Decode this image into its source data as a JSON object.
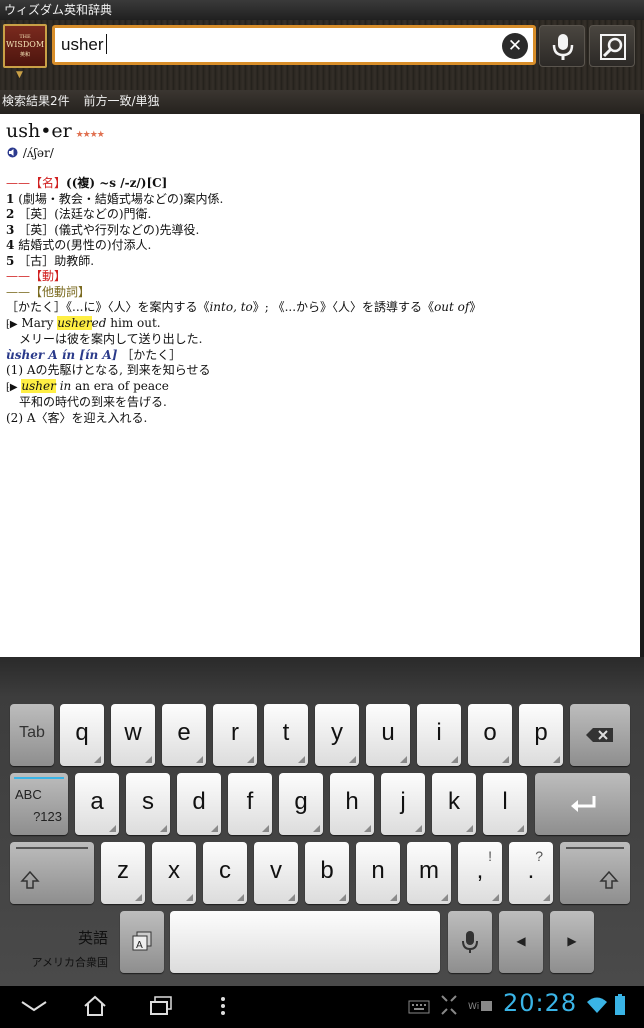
{
  "app": {
    "title": "ウィズダム英和辞典"
  },
  "logo": {
    "line1": "THE",
    "line2": "WISDOM",
    "line3": "英和"
  },
  "search": {
    "value": "usher"
  },
  "results": {
    "count": "検索結果2件",
    "mode": "前方一致/単独"
  },
  "entry": {
    "headword": "ush•er",
    "stars": "★★★★",
    "pron": "/ʌ́ʃər/",
    "pos1": "【名】",
    "plural": "((複) ~s /-z/)[C]",
    "senses": [
      {
        "num": "1",
        "text": "(劇場・教会・結婚式場などの)案内係."
      },
      {
        "num": "2",
        "text": "［英］(法廷などの)門衛."
      },
      {
        "num": "3",
        "text": "［英］(儀式や行列などの)先導役."
      },
      {
        "num": "4",
        "text": "結婚式の(男性の)付添人."
      },
      {
        "num": "5",
        "text": "［古］助教師."
      }
    ],
    "pos2": "【動】",
    "pos3": "【他動詞】",
    "verb_def_a": "［かたく］《...に》〈人〉を案内する《",
    "verb_def_b": "into, to",
    "verb_def_c": "》; 《...から》〈人〉を誘導する《",
    "verb_def_d": "out of",
    "verb_def_e": "》",
    "ex1_pre": "Mary ",
    "ex1_hl": "usher",
    "ex1_post_it": "ed",
    "ex1_post": " him out.",
    "ex1_ja": "メリーは彼を案内して送り出した.",
    "phrase": "ùsher A ín [ín A]",
    "phrase_reg": "［かたく］",
    "p1": "(1) Aの先駆けとなる, 到来を知らせる",
    "ex2_hl": "usher",
    "ex2_it": " in",
    "ex2_post": " an era of peace",
    "ex2_ja": "平和の時代の到来を告げる.",
    "p2": "(2) A〈客〉を迎え入れる."
  },
  "keyboard": {
    "row1": [
      "Tab",
      "q",
      "w",
      "e",
      "r",
      "t",
      "y",
      "u",
      "i",
      "o",
      "p"
    ],
    "row2": [
      "a",
      "s",
      "d",
      "f",
      "g",
      "h",
      "j",
      "k",
      "l"
    ],
    "row3": [
      "z",
      "x",
      "c",
      "v",
      "b",
      "n",
      "m",
      ",",
      "."
    ],
    "row3_sub": [
      "!",
      "?"
    ],
    "abc": "ABC",
    "sym": "?123",
    "ime_lang": "英語",
    "ime_region": "アメリカ合衆国"
  },
  "status": {
    "clock": "20:28"
  }
}
